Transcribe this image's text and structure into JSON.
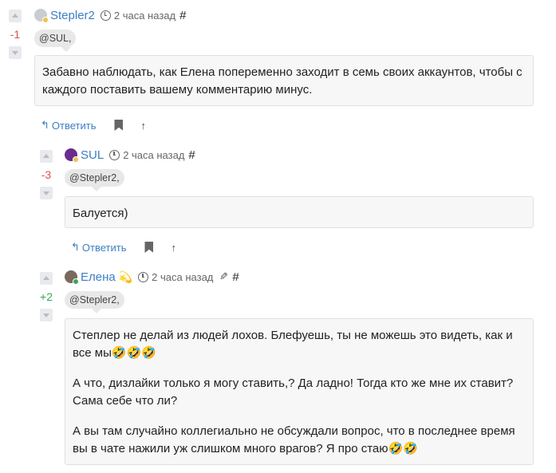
{
  "comments": [
    {
      "author": "Stepler2",
      "time": "2 часа назад",
      "hash": "#",
      "score": "-1",
      "mention": "@SUL,",
      "paragraphs": [
        "Забавно наблюдать, как Елена попеременно заходит в семь своих аккаунтов, чтобы с каждого поставить вашему комментарию минус."
      ],
      "reply_label": "Ответить",
      "avatar_color": "#c9ccd1",
      "status_color": "#f0c24b"
    },
    {
      "author": "SUL",
      "time": "2 часа назад",
      "hash": "#",
      "score": "-3",
      "mention": "@Stepler2,",
      "paragraphs": [
        "Балуется)"
      ],
      "reply_label": "Ответить",
      "avatar_color": "#6a2c8f",
      "status_color": "#f0c24b"
    },
    {
      "author": "Елена",
      "author_badge": "💫",
      "time": "2 часа назад",
      "hash": "#",
      "score": "+2",
      "mention": "@Stepler2,",
      "paragraphs": [
        "Степлер не делай из людей лохов. Блефуешь, ты не можешь это видеть, как и все мы🤣🤣🤣",
        "А что, дизлайки только я могу ставить,? Да ладно! Тогда кто же мне их ставит? Сама себе что ли?",
        "А вы там случайно коллегиально не обсуждали вопрос, что в последнее время вы в чате нажили уж слишком много врагов? Я про стаю🤣🤣"
      ],
      "avatar_color": "#7a6a5c",
      "status_color": "#3aa655"
    }
  ],
  "icons": {
    "reply": "↰",
    "upvote": "↑",
    "edit": "✎"
  },
  "colors": {
    "link": "#3b7fc4",
    "negative": "#d9534f",
    "positive": "#3aa655"
  }
}
